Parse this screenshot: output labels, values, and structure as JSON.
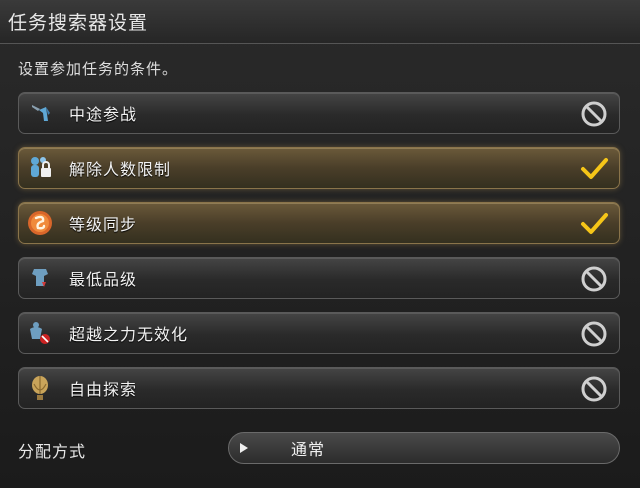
{
  "window": {
    "title": "任务搜索器设置"
  },
  "subtitle": "设置参加任务的条件。",
  "options": [
    {
      "label": "中途参战",
      "icon": "join-midway-icon",
      "state": "off"
    },
    {
      "label": "解除人数限制",
      "icon": "unlock-party-icon",
      "state": "on"
    },
    {
      "label": "等级同步",
      "icon": "level-sync-icon",
      "state": "on"
    },
    {
      "label": "最低品级",
      "icon": "minimum-ilvl-icon",
      "state": "off"
    },
    {
      "label": "超越之力无效化",
      "icon": "echo-disable-icon",
      "state": "off"
    },
    {
      "label": "自由探索",
      "icon": "explorer-balloon-icon",
      "state": "off"
    }
  ],
  "distribution": {
    "label": "分配方式",
    "value": "通常"
  },
  "colors": {
    "accent_check": "#f5c518",
    "active_row": "#5a4a2e",
    "inactive_row": "#2c2c2c"
  }
}
